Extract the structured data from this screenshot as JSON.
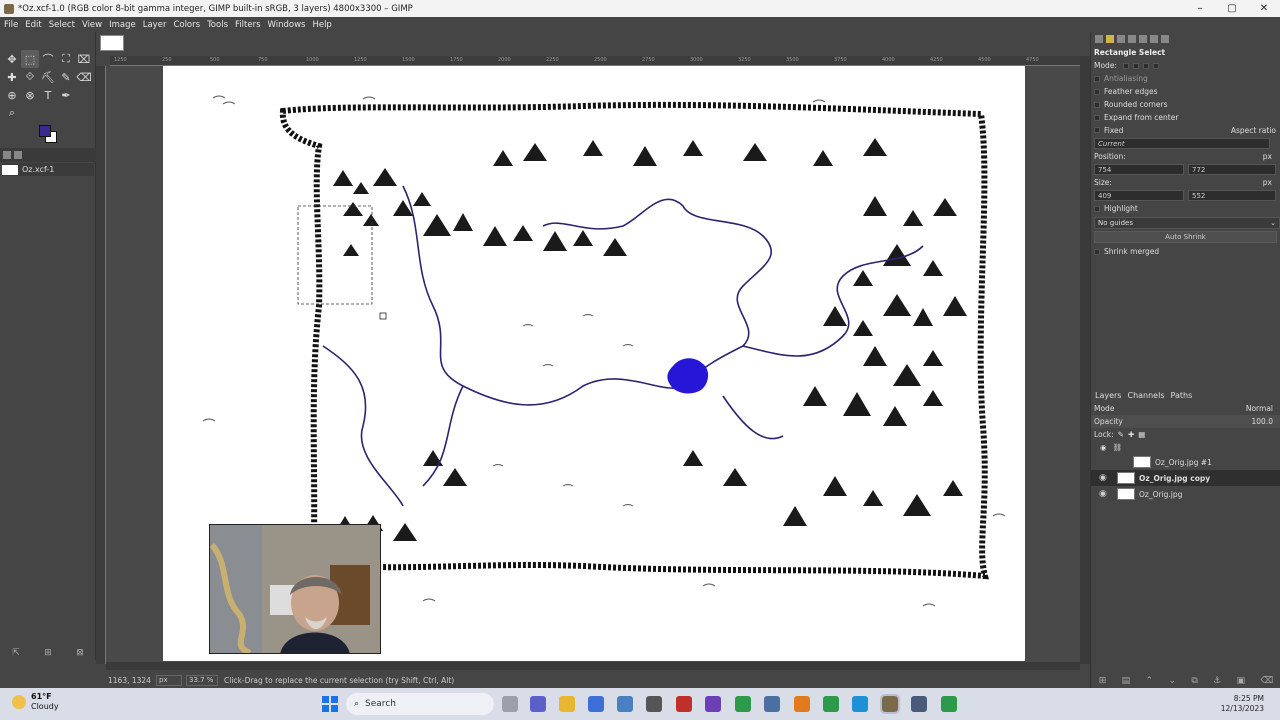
{
  "window": {
    "title": "*Oz.xcf-1.0 (RGB color 8-bit gamma integer, GIMP built-in sRGB, 3 layers) 4800x3300 – GIMP",
    "controls": [
      "–",
      "▢",
      "✕"
    ]
  },
  "menu": [
    "File",
    "Edit",
    "Select",
    "View",
    "Image",
    "Layer",
    "Colors",
    "Tools",
    "Filters",
    "Windows",
    "Help"
  ],
  "toolbox": {
    "tools": [
      "✥",
      "⬚",
      "⌒",
      "⛶",
      "⌧",
      "✚",
      "⟐",
      "⛏",
      "✎",
      "⌫",
      "⊕",
      "⊗",
      "T",
      "✒",
      "",
      "⌕"
    ],
    "image_name": "Oz.xcf-1",
    "fg_color": "#3a2a8e",
    "bg_color": "#ffffff"
  },
  "ruler": {
    "labels": [
      "1250",
      "250",
      "500",
      "750",
      "1000",
      "1250",
      "1500",
      "1750",
      "2000",
      "2250",
      "2500",
      "2750",
      "3000",
      "3250",
      "3500",
      "3750",
      "4000",
      "4250",
      "4500",
      "4750"
    ]
  },
  "status": {
    "coords": "1163, 1324",
    "unit": "px",
    "zoom": "33.7 %",
    "message": "Click-Drag to replace the current selection (try Shift, Ctrl, Alt)"
  },
  "tool_options": {
    "tool_name": "Rectangle Select",
    "mode_label": "Mode:",
    "antialiasing": "Antialiasing",
    "feather_edges": "Feather edges",
    "rounded_corners": "Rounded corners",
    "expand_from_center": "Expand from center",
    "fixed_label": "Fixed",
    "fixed_value": "Aspect ratio",
    "current": "Current",
    "position_label": "Position:",
    "position_unit": "px",
    "position_x": "754",
    "position_y": "772",
    "size_label": "Size:",
    "size_unit": "px",
    "size_w": "409",
    "size_h": "552",
    "highlight": "Highlight",
    "guides": "No guides",
    "auto_shrink": "Auto Shrink",
    "shrink_merged": "Shrink merged"
  },
  "layers_panel": {
    "tabs": [
      "Layers",
      "Channels",
      "Paths"
    ],
    "mode_label": "Mode",
    "mode_value": "Normal",
    "opacity_label": "Opacity",
    "opacity_value": "100.0",
    "lock_label": "Lock:",
    "layers": [
      {
        "name": "Oz_Orig.jpg #1",
        "visible": false
      },
      {
        "name": "Oz_Orig.jpg copy",
        "visible": true
      },
      {
        "name": "Oz_Orig.jpg",
        "visible": true
      }
    ]
  },
  "taskbar": {
    "temp": "61°F",
    "condition": "Cloudy",
    "search": "Search",
    "time": "8:25 PM",
    "date": "12/13/2023"
  }
}
